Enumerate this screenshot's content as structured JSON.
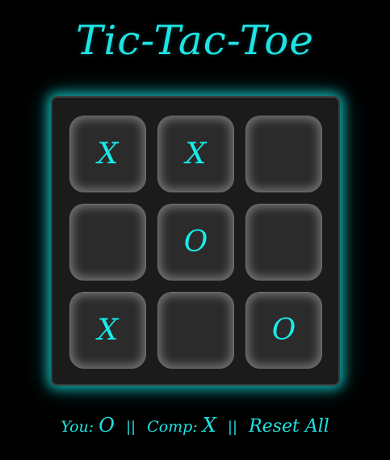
{
  "title": "Tic-Tac-Toe",
  "board": {
    "cells": [
      "X",
      "X",
      "",
      "",
      "O",
      "",
      "X",
      "",
      "O"
    ]
  },
  "scoreboard": {
    "you_label": "You:",
    "you_mark": "O",
    "separator": "||",
    "comp_label": "Comp:",
    "comp_mark": "X",
    "reset_label": "Reset All"
  },
  "colors": {
    "accent": "#1fe3e3",
    "background": "#000000",
    "board": "#1b1b1b",
    "cell": "#2b2b2b"
  }
}
